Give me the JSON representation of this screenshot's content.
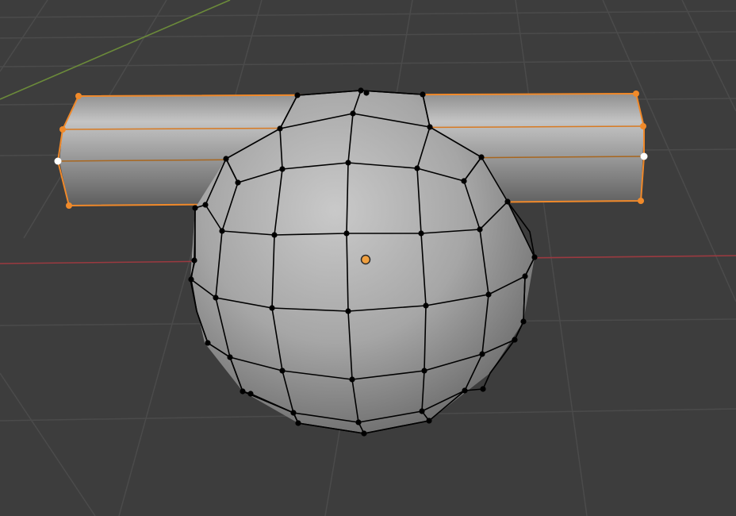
{
  "viewport": {
    "mode": "edit-mode",
    "background": "#3d3d3d",
    "grid_color": "#555555",
    "x_axis_color": "#9b3a40",
    "y_axis_color": "#6b8a3a"
  },
  "objects": [
    {
      "name": "cylinder",
      "selected": true,
      "outline_color": "#f0892a"
    },
    {
      "name": "uv-sphere",
      "selected": false,
      "wire_color": "#000000"
    }
  ],
  "origin_color": "#f0a040",
  "selection_color": "#f08a2a",
  "active_vertex_color": "#ffffff"
}
